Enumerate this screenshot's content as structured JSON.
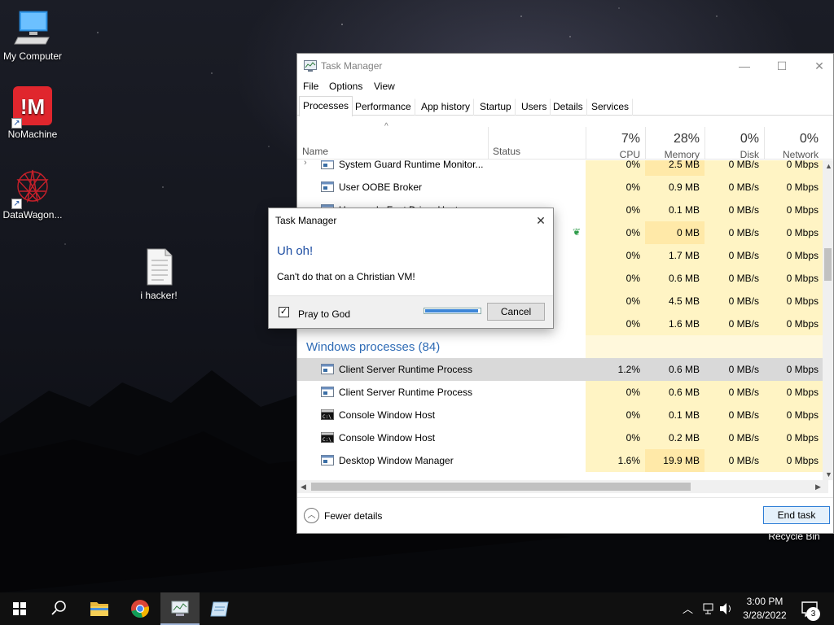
{
  "desktop": {
    "icons": [
      {
        "label": "My Computer"
      },
      {
        "label": "NoMachine"
      },
      {
        "label": "DataWagon..."
      },
      {
        "label": "i hacker!"
      },
      {
        "label": "Recycle Bin"
      }
    ]
  },
  "task_manager": {
    "title": "Task Manager",
    "menu": [
      "File",
      "Options",
      "View"
    ],
    "tabs": [
      "Processes",
      "Performance",
      "App history",
      "Startup",
      "Users",
      "Details",
      "Services"
    ],
    "active_tab": "Processes",
    "columns": {
      "name": "Name",
      "status": "Status",
      "cpu": {
        "pct": "7%",
        "label": "CPU"
      },
      "memory": {
        "pct": "28%",
        "label": "Memory"
      },
      "disk": {
        "pct": "0%",
        "label": "Disk"
      },
      "network": {
        "pct": "0%",
        "label": "Network"
      }
    },
    "rows": [
      {
        "name": "System Guard Runtime Monitor...",
        "cpu": "0%",
        "mem": "2.5 MB",
        "disk": "0 MB/s",
        "net": "0 Mbps"
      },
      {
        "name": "User OOBE Broker",
        "cpu": "0%",
        "mem": "0.9 MB",
        "disk": "0 MB/s",
        "net": "0 Mbps"
      },
      {
        "name": "Usermode Font Driver Host",
        "cpu": "0%",
        "mem": "0.1 MB",
        "disk": "0 MB/s",
        "net": "0 Mbps"
      },
      {
        "name": "",
        "cpu": "0%",
        "mem": "0 MB",
        "disk": "0 MB/s",
        "net": "0 Mbps"
      },
      {
        "name": "",
        "cpu": "0%",
        "mem": "1.7 MB",
        "disk": "0 MB/s",
        "net": "0 Mbps"
      },
      {
        "name": "",
        "cpu": "0%",
        "mem": "0.6 MB",
        "disk": "0 MB/s",
        "net": "0 Mbps"
      },
      {
        "name": "",
        "cpu": "0%",
        "mem": "4.5 MB",
        "disk": "0 MB/s",
        "net": "0 Mbps"
      },
      {
        "name": "",
        "cpu": "0%",
        "mem": "1.6 MB",
        "disk": "0 MB/s",
        "net": "0 Mbps"
      }
    ],
    "section": "Windows processes (84)",
    "windows_rows": [
      {
        "name": "Client Server Runtime Process",
        "cpu": "1.2%",
        "mem": "0.6 MB",
        "disk": "0 MB/s",
        "net": "0 Mbps"
      },
      {
        "name": "Client Server Runtime Process",
        "cpu": "0%",
        "mem": "0.6 MB",
        "disk": "0 MB/s",
        "net": "0 Mbps"
      },
      {
        "name": "Console Window Host",
        "cpu": "0%",
        "mem": "0.1 MB",
        "disk": "0 MB/s",
        "net": "0 Mbps"
      },
      {
        "name": "Console Window Host",
        "cpu": "0%",
        "mem": "0.2 MB",
        "disk": "0 MB/s",
        "net": "0 Mbps"
      },
      {
        "name": "Desktop Window Manager",
        "cpu": "1.6%",
        "mem": "19.9 MB",
        "disk": "0 MB/s",
        "net": "0 Mbps"
      }
    ],
    "fewer_details": "Fewer details",
    "end_task": "End task"
  },
  "dialog": {
    "title": "Task Manager",
    "heading": "Uh oh!",
    "message": "Can't do that on a Christian VM!",
    "checkbox_label": "Pray to God",
    "checkbox_checked": true,
    "progress": 0.97,
    "cancel": "Cancel"
  },
  "taskbar": {
    "time": "3:00 PM",
    "date": "3/28/2022",
    "notifications": "3"
  },
  "colors": {
    "accent": "#2e6bb5",
    "heat_light": "#fff4c4",
    "heat_mid": "#ffe9a8",
    "selected_row": "#d9d9d9"
  }
}
